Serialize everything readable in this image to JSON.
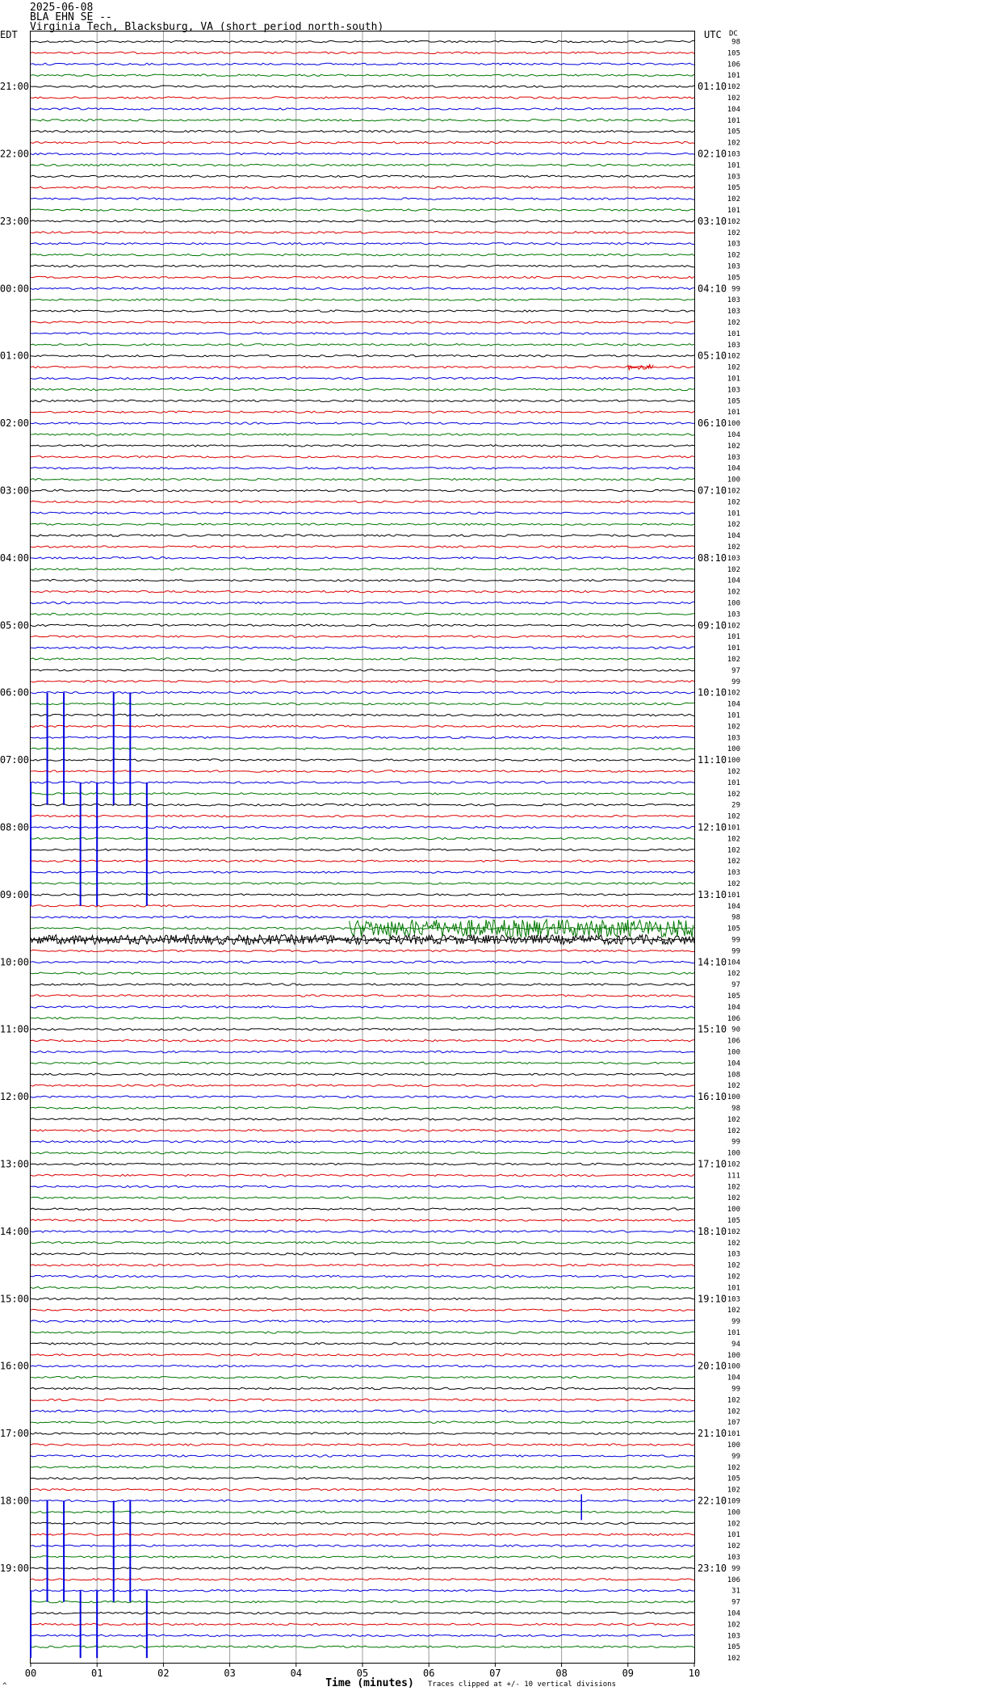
{
  "header": {
    "date": "2025-06-08",
    "station": "BLA EHN SE --",
    "location": "Virginia Tech, Blacksburg, VA (short period north-south)"
  },
  "chart_data": {
    "type": "helicorder",
    "left_timezone": "EDT",
    "right_timezone": "UTC",
    "dc_label": "DC",
    "minutes_per_line": 10,
    "line_count": 144,
    "trace_colors": [
      "#000000",
      "#dd0000",
      "#0000dd",
      "#007700"
    ],
    "grid_color": "#9a9a9a",
    "xlabel": "Time (minutes)",
    "x_ticks": [
      "00",
      "01",
      "02",
      "03",
      "04",
      "05",
      "06",
      "07",
      "08",
      "09",
      "10"
    ],
    "left_hour_labels": [
      "21:00",
      "22:00",
      "23:00",
      "00:00",
      "01:00",
      "02:00",
      "03:00",
      "04:00",
      "05:00",
      "06:00",
      "07:00",
      "08:00",
      "09:00",
      "10:00",
      "11:00",
      "12:00",
      "13:00",
      "14:00",
      "15:00",
      "16:00",
      "17:00",
      "18:00",
      "19:00"
    ],
    "right_hour_labels": [
      "01:10",
      "02:10",
      "03:10",
      "04:10",
      "05:10",
      "06:10",
      "07:10",
      "08:10",
      "09:10",
      "10:10",
      "11:10",
      "12:10",
      "13:10",
      "14:10",
      "15:10",
      "16:10",
      "17:10",
      "18:10",
      "19:10",
      "20:10",
      "21:10",
      "22:10",
      "23:10"
    ],
    "dc_offsets": [
      "98",
      "105",
      "106",
      "101",
      "102",
      "102",
      "104",
      "101",
      "105",
      "102",
      "103",
      "101",
      "103",
      "105",
      "102",
      "101",
      "102",
      "102",
      "103",
      "102",
      "103",
      "105",
      "99",
      "103",
      "103",
      "102",
      "101",
      "103",
      "102",
      "102",
      "101",
      "103",
      "105",
      "101",
      "100",
      "104",
      "102",
      "103",
      "104",
      "100",
      "102",
      "102",
      "101",
      "102",
      "104",
      "102",
      "103",
      "102",
      "104",
      "102",
      "100",
      "103",
      "102",
      "101",
      "101",
      "102",
      "97",
      "99",
      "102",
      "104",
      "101",
      "102",
      "103",
      "100",
      "100",
      "102",
      "101",
      "102",
      "29",
      "102",
      "101",
      "102",
      "102",
      "102",
      "103",
      "102",
      "101",
      "104",
      "98",
      "105",
      "99",
      "99",
      "104",
      "102",
      "97",
      "105",
      "104",
      "106",
      "90",
      "106",
      "100",
      "104",
      "108",
      "102",
      "100",
      "98",
      "102",
      "102",
      "99",
      "100",
      "102",
      "111",
      "102",
      "102",
      "100",
      "105",
      "102",
      "102",
      "103",
      "102",
      "102",
      "101",
      "103",
      "102",
      "99",
      "101",
      "94",
      "100",
      "100",
      "104",
      "99",
      "102",
      "102",
      "107",
      "101",
      "100",
      "99",
      "102",
      "105",
      "102",
      "109",
      "100",
      "102",
      "101",
      "102",
      "103",
      "99",
      "106",
      "31",
      "97",
      "104",
      "102",
      "103",
      "105",
      "102"
    ],
    "events": [
      {
        "desc": "small burst",
        "line": 29,
        "start_min": 9.0,
        "end_min": 9.4
      },
      {
        "desc": "clipped spikes",
        "from_line": 58,
        "to_line": 68,
        "minutes": [
          0.25,
          0.5,
          1.25,
          1.5
        ]
      },
      {
        "desc": "clipped spikes",
        "from_line": 66,
        "to_line": 77,
        "minutes": [
          0.0,
          0.75,
          1.0,
          1.75
        ]
      },
      {
        "desc": "large noise",
        "line": 80,
        "start_min": 0.0,
        "end_min": 10.0
      },
      {
        "desc": "large noise",
        "line": 79,
        "start_min": 4.8,
        "end_min": 10.0
      },
      {
        "desc": "spike",
        "line": 131,
        "minute": 8.3
      },
      {
        "desc": "clipped spikes",
        "from_line": 130,
        "to_line": 139,
        "minutes": [
          0.25,
          0.5,
          1.25,
          1.5
        ]
      },
      {
        "desc": "clipped spikes",
        "from_line": 138,
        "to_line": 144,
        "minutes": [
          0.0,
          0.75,
          1.0,
          1.75
        ]
      }
    ],
    "footnote": "Traces clipped at +/- 10 vertical divisions"
  }
}
